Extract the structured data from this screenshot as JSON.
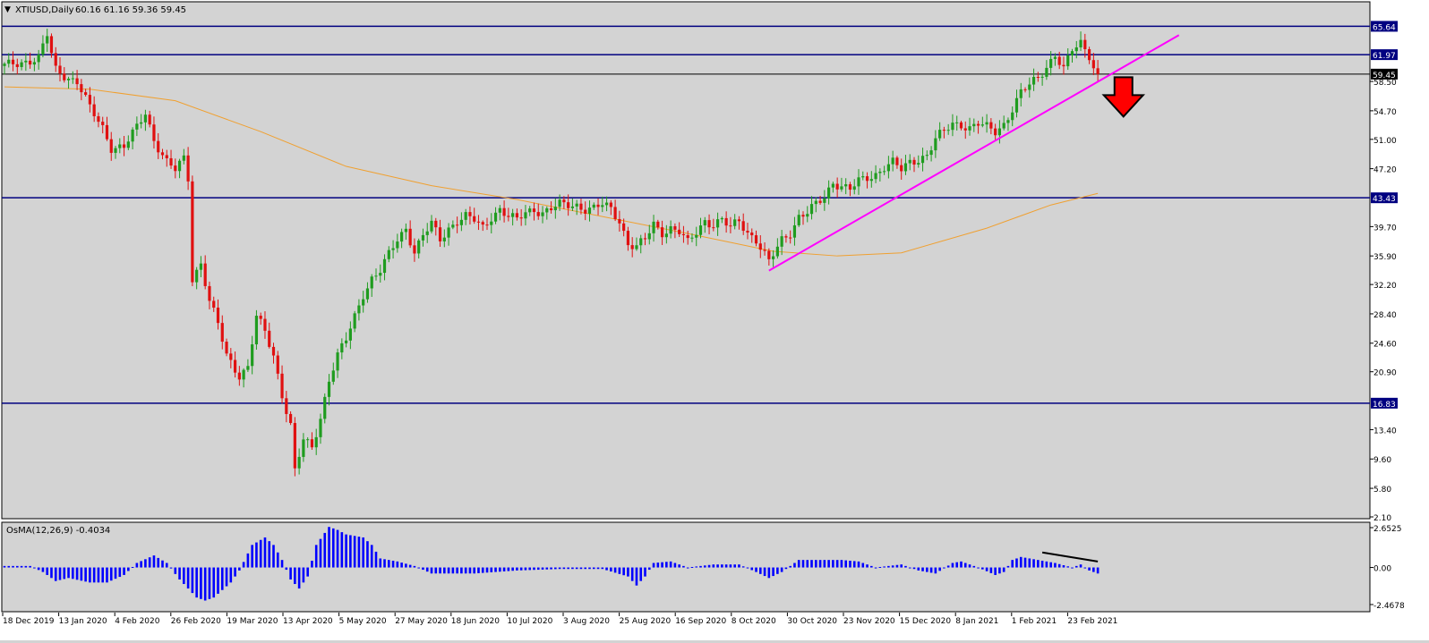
{
  "header": {
    "collapse_glyph": "▼",
    "symbol": "XTIUSD,Daily",
    "ohlc": "60.16 61.16 59.36 59.45"
  },
  "indicator": {
    "label": "OsMA(12,26,9) -0.4034"
  },
  "colors": {
    "chart_bg": "#d3d3d3",
    "bull_candle": "#1f9c1f",
    "bear_candle": "#e01010",
    "level_line": "#000080",
    "moving_average": "#f0a030",
    "trendline": "#ff00ff",
    "histogram": "#0000ff",
    "arrow": "#ff0000"
  },
  "icons": {
    "sell_arrow": "down-arrow-icon",
    "collapse": "triangle-down-icon"
  },
  "chart_data": [
    {
      "type": "candlestick",
      "title": "XTIUSD,Daily",
      "ylim": [
        2.1,
        66.5
      ],
      "price_ticks": [
        "58.50",
        "54.70",
        "51.00",
        "47.20",
        "39.70",
        "35.90",
        "32.20",
        "28.40",
        "24.60",
        "20.90",
        "13.40",
        "9.60",
        "5.80",
        "2.10"
      ],
      "levels": [
        {
          "label": "65.64",
          "value": 65.64,
          "style": "line"
        },
        {
          "label": "61.97",
          "value": 61.97,
          "style": "line"
        },
        {
          "label": "59.45",
          "value": 59.45,
          "style": "current"
        },
        {
          "label": "43.43",
          "value": 43.43,
          "style": "line"
        },
        {
          "label": "16.83",
          "value": 16.83,
          "style": "line"
        }
      ],
      "x_labels": [
        "18 Dec 2019",
        "13 Jan 2020",
        "4 Feb 2020",
        "26 Feb 2020",
        "19 Mar 2020",
        "13 Apr 2020",
        "5 May 2020",
        "27 May 2020",
        "18 Jun 2020",
        "10 Jul 2020",
        "3 Aug 2020",
        "25 Aug 2020",
        "16 Sep 2020",
        "8 Oct 2020",
        "30 Oct 2020",
        "23 Nov 2020",
        "15 Dec 2020",
        "8 Jan 2021",
        "1 Feb 2021",
        "23 Feb 2021"
      ],
      "price_path": [
        [
          0,
          60.5
        ],
        [
          8,
          61.5
        ],
        [
          10,
          64.5
        ],
        [
          11,
          62.0
        ],
        [
          12,
          60.0
        ],
        [
          15,
          59.0
        ],
        [
          17,
          58.5
        ],
        [
          20,
          55.0
        ],
        [
          23,
          52.5
        ],
        [
          25,
          50.0
        ],
        [
          28,
          50.0
        ],
        [
          31,
          52.5
        ],
        [
          33,
          54.5
        ],
        [
          35,
          51.0
        ],
        [
          38,
          48.0
        ],
        [
          40,
          47.0
        ],
        [
          42,
          48.5
        ],
        [
          43,
          46.0
        ],
        [
          44,
          33.0
        ],
        [
          46,
          35.0
        ],
        [
          48,
          30.0
        ],
        [
          50,
          27.0
        ],
        [
          52,
          23.0
        ],
        [
          55,
          20.5
        ],
        [
          57,
          21.5
        ],
        [
          59,
          28.0
        ],
        [
          61,
          26.0
        ],
        [
          63,
          23.0
        ],
        [
          65,
          18.0
        ],
        [
          67,
          14.0
        ],
        [
          68,
          8.0
        ],
        [
          70,
          12.0
        ],
        [
          72,
          11.0
        ],
        [
          74,
          15.0
        ],
        [
          76,
          20.0
        ],
        [
          78,
          23.0
        ],
        [
          80,
          25.0
        ],
        [
          82,
          28.0
        ],
        [
          84,
          31.0
        ],
        [
          86,
          33.0
        ],
        [
          88,
          34.0
        ],
        [
          90,
          36.0
        ],
        [
          92,
          38.0
        ],
        [
          94,
          39.5
        ],
        [
          96,
          36.5
        ],
        [
          98,
          38.5
        ],
        [
          100,
          40.0
        ],
        [
          102,
          38.0
        ],
        [
          104,
          39.5
        ],
        [
          106,
          40.5
        ],
        [
          108,
          41.0
        ],
        [
          110,
          40.5
        ],
        [
          112,
          39.5
        ],
        [
          114,
          41.0
        ],
        [
          116,
          42.0
        ],
        [
          118,
          41.0
        ],
        [
          120,
          40.5
        ],
        [
          122,
          41.5
        ],
        [
          124,
          42.0
        ],
        [
          126,
          41.5
        ],
        [
          128,
          42.0
        ],
        [
          130,
          42.5
        ],
        [
          132,
          42.5
        ],
        [
          134,
          42.5
        ],
        [
          136,
          42.0
        ],
        [
          138,
          42.0
        ],
        [
          140,
          42.5
        ],
        [
          142,
          42.0
        ],
        [
          144,
          40.5
        ],
        [
          146,
          37.5
        ],
        [
          148,
          37.0
        ],
        [
          150,
          38.0
        ],
        [
          152,
          40.0
        ],
        [
          154,
          39.0
        ],
        [
          156,
          39.5
        ],
        [
          158,
          39.0
        ],
        [
          160,
          37.5
        ],
        [
          162,
          39.0
        ],
        [
          164,
          40.5
        ],
        [
          166,
          40.0
        ],
        [
          168,
          40.5
        ],
        [
          170,
          39.5
        ],
        [
          172,
          40.5
        ],
        [
          174,
          39.0
        ],
        [
          176,
          38.0
        ],
        [
          178,
          36.0
        ],
        [
          179,
          35.0
        ],
        [
          180,
          36.0
        ],
        [
          182,
          38.0
        ],
        [
          184,
          39.0
        ],
        [
          186,
          41.0
        ],
        [
          188,
          41.5
        ],
        [
          190,
          42.5
        ],
        [
          192,
          43.5
        ],
        [
          194,
          45.5
        ],
        [
          196,
          45.0
        ],
        [
          198,
          44.5
        ],
        [
          200,
          45.5
        ],
        [
          202,
          46.0
        ],
        [
          204,
          46.5
        ],
        [
          206,
          47.5
        ],
        [
          208,
          48.0
        ],
        [
          210,
          47.0
        ],
        [
          212,
          48.0
        ],
        [
          214,
          48.5
        ],
        [
          216,
          49.0
        ],
        [
          218,
          51.0
        ],
        [
          220,
          52.0
        ],
        [
          222,
          53.0
        ],
        [
          224,
          53.0
        ],
        [
          226,
          52.5
        ],
        [
          228,
          53.0
        ],
        [
          230,
          52.5
        ],
        [
          232,
          52.0
        ],
        [
          234,
          53.0
        ],
        [
          236,
          55.0
        ],
        [
          238,
          57.0
        ],
        [
          240,
          58.0
        ],
        [
          242,
          59.0
        ],
        [
          244,
          60.5
        ],
        [
          246,
          62.0
        ],
        [
          248,
          60.0
        ],
        [
          250,
          62.5
        ],
        [
          252,
          63.5
        ],
        [
          254,
          62.0
        ],
        [
          255,
          60.5
        ],
        [
          256,
          59.45
        ]
      ],
      "moving_average_path": [
        [
          0,
          57.8
        ],
        [
          20,
          57.5
        ],
        [
          40,
          56.0
        ],
        [
          60,
          52.0
        ],
        [
          80,
          47.5
        ],
        [
          100,
          45.0
        ],
        [
          120,
          43.2
        ],
        [
          140,
          41.0
        ],
        [
          160,
          38.8
        ],
        [
          180,
          36.5
        ],
        [
          195,
          35.9
        ],
        [
          210,
          36.3
        ],
        [
          230,
          39.5
        ],
        [
          245,
          42.5
        ],
        [
          256,
          44.0
        ]
      ],
      "trendline": {
        "from": [
          179,
          34.0
        ],
        "to": [
          275,
          64.5
        ]
      },
      "annotation": {
        "type": "sell-arrow",
        "bar": 262,
        "value": 56.5
      }
    },
    {
      "type": "histogram",
      "title": "OsMA(12,26,9) -0.4034",
      "ylim": [
        -2.4678,
        2.6525
      ],
      "ticks": [
        "2.6525",
        "0.00",
        "-2.4678"
      ],
      "values_path": [
        [
          0,
          0.1
        ],
        [
          6,
          0.1
        ],
        [
          9,
          -0.3
        ],
        [
          12,
          -0.9
        ],
        [
          15,
          -0.7
        ],
        [
          20,
          -1.0
        ],
        [
          24,
          -1.0
        ],
        [
          28,
          -0.5
        ],
        [
          31,
          0.3
        ],
        [
          35,
          0.8
        ],
        [
          38,
          0.3
        ],
        [
          41,
          -0.8
        ],
        [
          45,
          -2.0
        ],
        [
          47,
          -2.2
        ],
        [
          49,
          -2.0
        ],
        [
          53,
          -1.0
        ],
        [
          55,
          -0.2
        ],
        [
          58,
          1.5
        ],
        [
          61,
          2.0
        ],
        [
          63,
          1.5
        ],
        [
          65,
          0.5
        ],
        [
          67,
          -0.8
        ],
        [
          69,
          -1.4
        ],
        [
          71,
          -0.6
        ],
        [
          73,
          1.5
        ],
        [
          76,
          2.7
        ],
        [
          78,
          2.5
        ],
        [
          80,
          2.2
        ],
        [
          84,
          2.0
        ],
        [
          86,
          1.5
        ],
        [
          88,
          0.6
        ],
        [
          92,
          0.4
        ],
        [
          96,
          0.1
        ],
        [
          100,
          -0.4
        ],
        [
          110,
          -0.4
        ],
        [
          120,
          -0.2
        ],
        [
          130,
          -0.1
        ],
        [
          140,
          -0.1
        ],
        [
          146,
          -0.6
        ],
        [
          148,
          -1.2
        ],
        [
          150,
          -0.6
        ],
        [
          152,
          0.3
        ],
        [
          156,
          0.4
        ],
        [
          160,
          0.0
        ],
        [
          166,
          0.2
        ],
        [
          172,
          0.2
        ],
        [
          176,
          -0.3
        ],
        [
          179,
          -0.7
        ],
        [
          182,
          -0.3
        ],
        [
          186,
          0.5
        ],
        [
          190,
          0.5
        ],
        [
          196,
          0.5
        ],
        [
          200,
          0.4
        ],
        [
          204,
          0.0
        ],
        [
          210,
          0.2
        ],
        [
          214,
          -0.2
        ],
        [
          218,
          -0.4
        ],
        [
          222,
          0.3
        ],
        [
          224,
          0.4
        ],
        [
          228,
          0.0
        ],
        [
          232,
          -0.5
        ],
        [
          234,
          -0.3
        ],
        [
          236,
          0.5
        ],
        [
          238,
          0.7
        ],
        [
          242,
          0.5
        ],
        [
          246,
          0.3
        ],
        [
          250,
          0.0
        ],
        [
          252,
          0.2
        ],
        [
          254,
          -0.2
        ],
        [
          256,
          -0.4
        ]
      ],
      "divergence_line": {
        "from": [
          243,
          1.0
        ],
        "to": [
          256,
          0.4
        ]
      }
    }
  ]
}
